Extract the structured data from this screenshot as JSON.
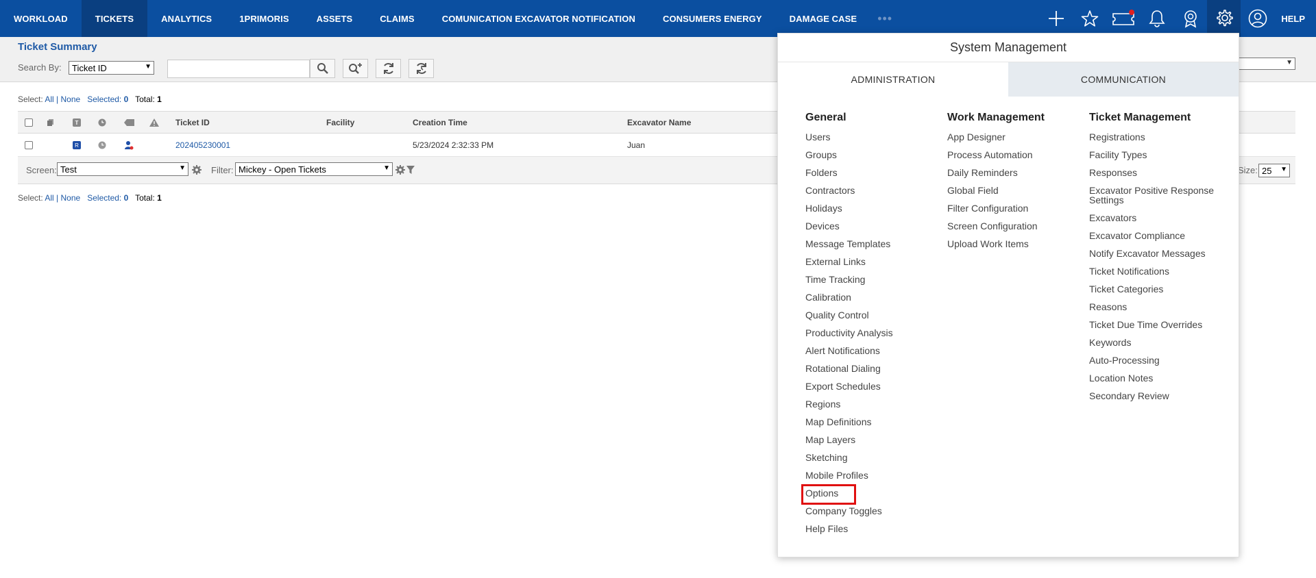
{
  "nav": {
    "items": [
      "WORKLOAD",
      "TICKETS",
      "ANALYTICS",
      "1PRIMORIS",
      "ASSETS",
      "CLAIMS",
      "COMUNICATION EXCAVATOR NOTIFICATION",
      "CONSUMERS ENERGY",
      "DAMAGE CASE"
    ],
    "more": "•••",
    "help": "HELP"
  },
  "header": {
    "title": "Ticket Summary",
    "search_by_label": "Search By:",
    "search_by_value": "Ticket ID",
    "search_value": ""
  },
  "selection": {
    "select_label": "Select:",
    "all": "All",
    "sep": "|",
    "none": "None",
    "selected_label": "Selected:",
    "selected_count": "0",
    "total_label": "Total:",
    "total_count": "1"
  },
  "table": {
    "columns": [
      "Ticket ID",
      "Facility",
      "Creation Time",
      "Excavator Name"
    ],
    "rows": [
      {
        "ticket_id": "202405230001",
        "facility": "",
        "creation_time": "5/23/2024 2:32:33 PM",
        "excavator": "Juan",
        "priority_badge": "R"
      }
    ],
    "footer": {
      "screen_label": "Screen:",
      "screen_value": "Test",
      "filter_label": "Filter:",
      "filter_value": "Mickey - Open Tickets",
      "size_label": "Size:",
      "size_value": "25"
    }
  },
  "menu": {
    "title": "System Management",
    "tabs": [
      "ADMINISTRATION",
      "COMMUNICATION"
    ],
    "general": {
      "heading": "General",
      "items": [
        "Users",
        "Groups",
        "Folders",
        "Contractors",
        "Holidays",
        "Devices",
        "Message Templates",
        "External Links",
        "Time Tracking",
        "Calibration",
        "Quality Control",
        "Productivity Analysis",
        "Alert Notifications",
        "Rotational Dialing",
        "Export Schedules",
        "Regions",
        "Map Definitions",
        "Map Layers",
        "Sketching",
        "Mobile Profiles",
        "Options",
        "Company Toggles",
        "Help Files"
      ]
    },
    "work": {
      "heading": "Work Management",
      "items": [
        "App Designer",
        "Process Automation",
        "Daily Reminders",
        "Global Field",
        "Filter Configuration",
        "Screen Configuration",
        "Upload Work Items"
      ]
    },
    "ticket": {
      "heading": "Ticket Management",
      "items": [
        "Registrations",
        "Facility Types",
        "Responses",
        "Excavator Positive Response Settings",
        "Excavators",
        "Excavator Compliance",
        "Notify Excavator Messages",
        "Ticket Notifications",
        "Ticket Categories",
        "Reasons",
        "Ticket Due Time Overrides",
        "Keywords",
        "Auto-Processing",
        "Location Notes",
        "Secondary Review"
      ]
    }
  },
  "colors": {
    "nav_bg": "#0b4fa0",
    "nav_active": "#0a3f80",
    "link": "#1f5aa6",
    "highlight_box": "#e01010"
  }
}
